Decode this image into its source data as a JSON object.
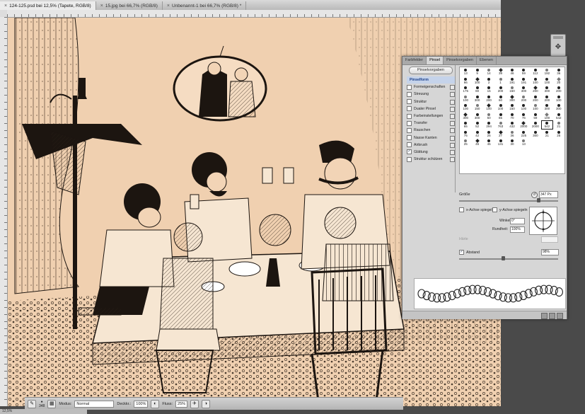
{
  "tabs": [
    {
      "label": "124-125.psd bei 12,5% (Tapete, RGB/8)",
      "active": true
    },
    {
      "label": "15.jpg bei 66,7% (RGB/8)",
      "active": false
    },
    {
      "label": "Unbenannt-1 bei 66,7% (RGB/8) *",
      "active": false
    }
  ],
  "panel": {
    "tabs": [
      "Farbfelder",
      "Pinsel",
      "Pinselvorgaben",
      "Ebenen"
    ],
    "active_tab": "Pinsel",
    "preset_button": "Pinselvorgaben",
    "options": [
      {
        "label": "Pinselform",
        "header": true,
        "checked": false
      },
      {
        "label": "Formeigenschaften",
        "checked": false
      },
      {
        "label": "Streuung",
        "checked": false
      },
      {
        "label": "Struktur",
        "checked": false
      },
      {
        "label": "Dualer Pinsel",
        "checked": false
      },
      {
        "label": "Farbeinstellungen",
        "checked": false
      },
      {
        "label": "Transfer",
        "checked": false
      },
      {
        "label": "Rauschen",
        "checked": false
      },
      {
        "label": "Nasse Kanten",
        "checked": false
      },
      {
        "label": "Airbrush",
        "checked": false
      },
      {
        "label": "Glättung",
        "checked": true
      },
      {
        "label": "Struktur schützen",
        "checked": false
      }
    ],
    "brush_sizes": [
      "13",
      "9",
      "14",
      "39",
      "46",
      "59",
      "112",
      "192",
      "36",
      "66",
      "100",
      "2",
      "1",
      "191",
      "191",
      "100",
      "100",
      "20",
      "175",
      "80",
      "15",
      "200",
      "150",
      "300",
      "200",
      "300",
      "200",
      "100",
      "300",
      "200",
      "60",
      "300",
      "200",
      "200",
      "200",
      "100",
      "100",
      "150",
      "100",
      "100",
      "150",
      "100",
      "100",
      "300",
      "300",
      "300",
      "300",
      "50",
      "65",
      "70",
      "76",
      "59",
      "100",
      "542",
      "65",
      "52",
      "294",
      "763",
      "432",
      "2000",
      "2000",
      "542",
      "21",
      "75",
      "42",
      "25",
      "27",
      "36",
      "225",
      "300",
      "21",
      "25",
      "25",
      "45",
      "45",
      "131",
      "30",
      "13"
    ],
    "selected_brush_index": 61,
    "size_label": "Größe",
    "size_value": "347 Px",
    "flip_x": "x-Achse spiegeln",
    "flip_y": "y-Achse spiegeln",
    "angle_label": "Winkel:",
    "angle_value": "0°",
    "roundness_label": "Rundheit:",
    "roundness_value": "100%",
    "hardness_label": "Härte",
    "spacing_label": "Abstand",
    "spacing_value": "98%"
  },
  "options_bar": {
    "brush_size": "348",
    "mode_label": "Modus:",
    "mode_value": "Normal",
    "opacity_label": "Deckkr.:",
    "opacity_value": "100%",
    "flow_label": "Fluss:",
    "flow_value": "25%"
  },
  "status": {
    "text": "12,5%"
  },
  "colors": {
    "canvas": "#f2d4b6",
    "ink": "#1c1510",
    "panel": "#d6d6d6"
  }
}
